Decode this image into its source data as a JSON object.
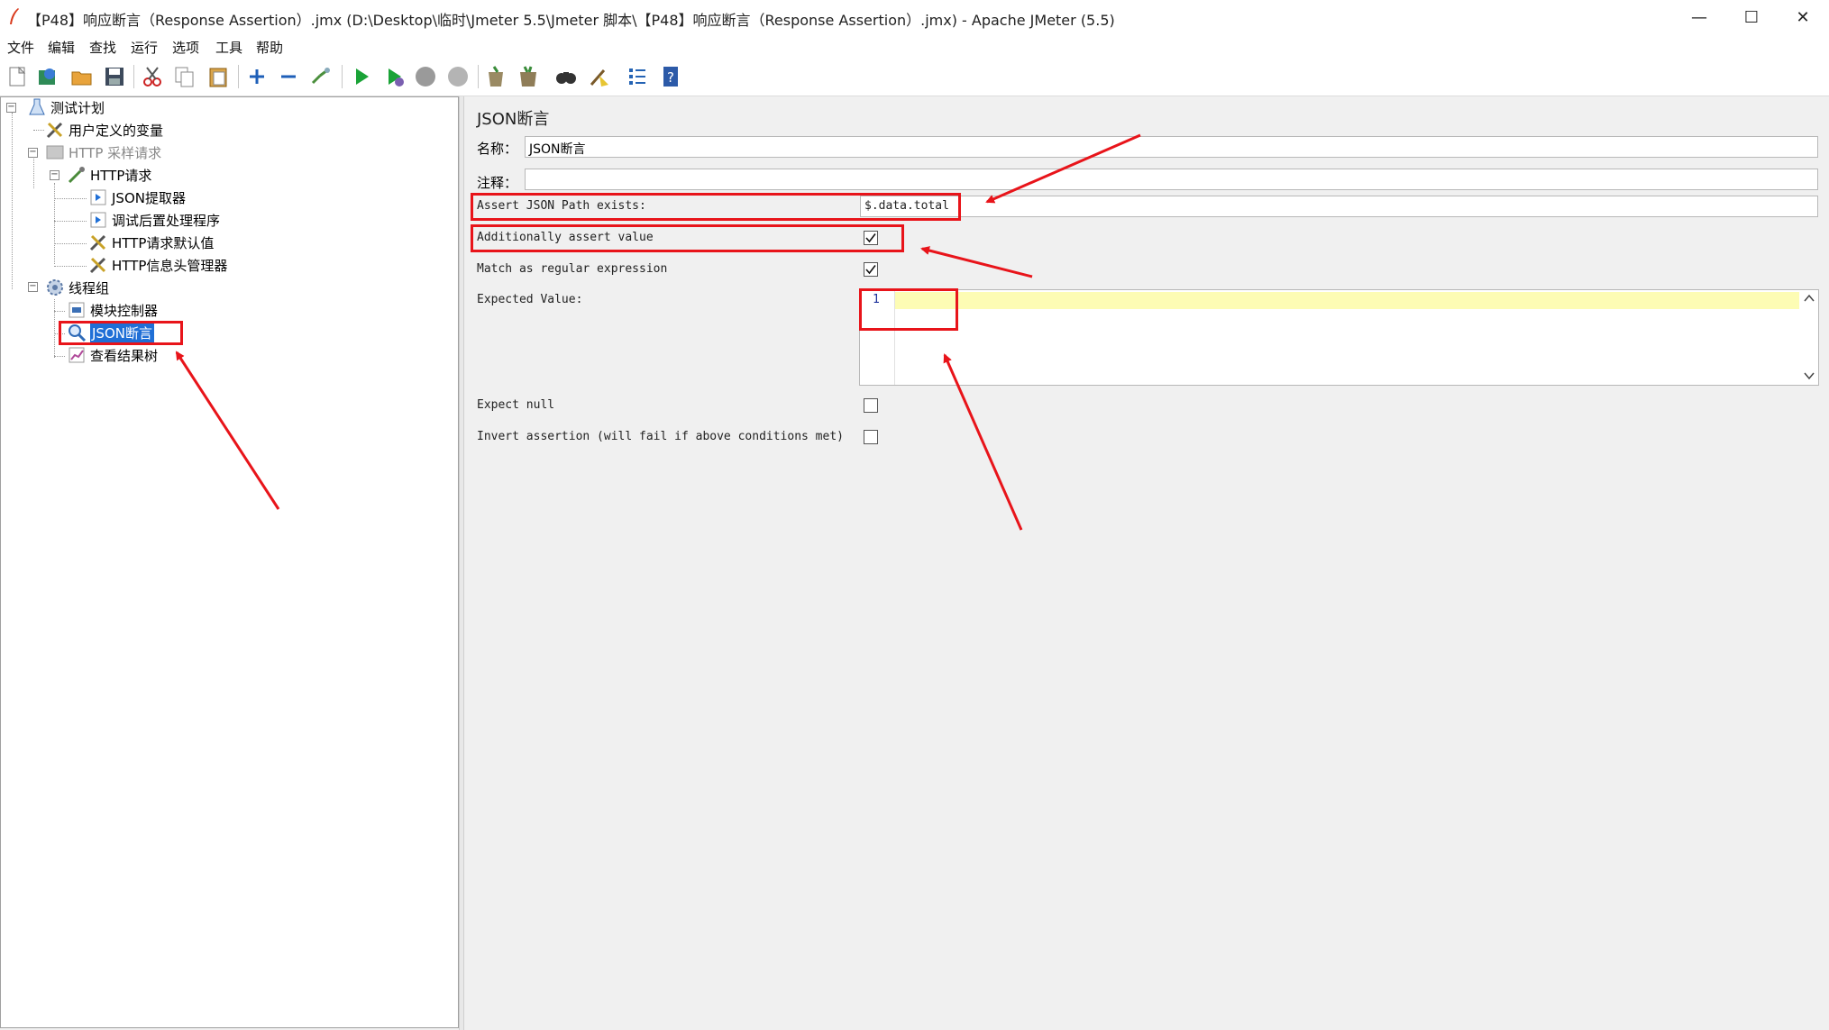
{
  "window": {
    "title": "【P48】响应断言（Response Assertion）.jmx (D:\\Desktop\\临时\\Jmeter 5.5\\Jmeter 脚本\\【P48】响应断言（Response Assertion）.jmx) - Apache JMeter (5.5)",
    "minimize": "—",
    "maximize": "☐",
    "close": "✕"
  },
  "menu": [
    "文件",
    "编辑",
    "查找",
    "运行",
    "选项",
    "工具",
    "帮助"
  ],
  "toolbar": [
    "new-icon",
    "templates-icon",
    "open-icon",
    "save-icon",
    "cut-icon",
    "copy-icon",
    "paste-icon",
    "expand-icon",
    "collapse-icon",
    "toggle-icon",
    "start-icon",
    "start-no-pause-icon",
    "stop-icon",
    "shutdown-icon",
    "clear-icon",
    "clear-all-icon",
    "search-icon",
    "reset-search-icon",
    "function-helper-icon",
    "help-icon"
  ],
  "tree": {
    "test_plan": "测试计划",
    "user_vars": "用户定义的变量",
    "http_sampler_group": "HTTP 采样请求",
    "http_request": "HTTP请求",
    "json_extractor": "JSON提取器",
    "debug_postprocessor": "调试后置处理程序",
    "http_defaults": "HTTP请求默认值",
    "header_manager": "HTTP信息头管理器",
    "thread_group": "线程组",
    "module_controller": "模块控制器",
    "json_assertion": "JSON断言",
    "view_results_tree": "查看结果树"
  },
  "panel": {
    "heading": "JSON断言",
    "name_label": "名称：",
    "name_value": "JSON断言",
    "comment_label": "注释：",
    "comment_value": "",
    "assert_path_label": "Assert JSON Path exists:",
    "assert_path_value": "$.data.total",
    "additionally_label": "Additionally assert value",
    "additionally_checked": true,
    "regex_label": "Match as regular expression",
    "regex_checked": true,
    "expected_label": "Expected Value:",
    "expected_line_number": "1",
    "expected_value": "",
    "expect_null_label": "Expect null",
    "expect_null_checked": false,
    "invert_label": "Invert assertion (will fail if above conditions met)",
    "invert_checked": false
  },
  "colors": {
    "annotation_red": "#e8141a",
    "selection_blue": "#1f6fd6",
    "editor_highlight": "#fdfcb4"
  }
}
